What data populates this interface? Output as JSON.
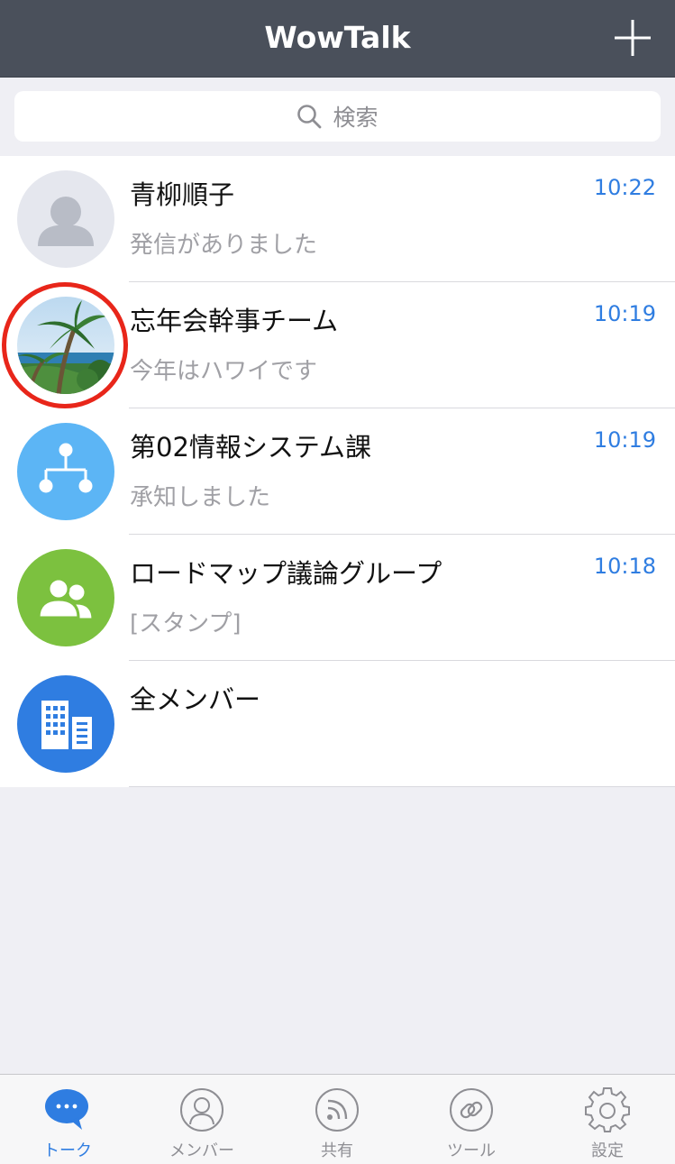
{
  "header": {
    "title": "WowTalk"
  },
  "search": {
    "placeholder": "検索"
  },
  "chats": [
    {
      "name": "青柳順子",
      "time": "10:22",
      "preview": "発信がありました",
      "avatar": "person-icon"
    },
    {
      "name": "忘年会幹事チーム",
      "time": "10:19",
      "preview": "今年はハワイです",
      "avatar": "palm-beach-photo"
    },
    {
      "name": "第02情報システム課",
      "time": "10:19",
      "preview": "承知しました",
      "avatar": "org-chart-icon"
    },
    {
      "name": "ロードマップ議論グループ",
      "time": "10:18",
      "preview": "[スタンプ]",
      "avatar": "group-icon"
    },
    {
      "name": "全メンバー",
      "time": "",
      "preview": "",
      "avatar": "building-icon"
    }
  ],
  "tabs": [
    {
      "label": "トーク",
      "icon": "chat-bubble-icon",
      "active": true
    },
    {
      "label": "メンバー",
      "icon": "member-icon",
      "active": false
    },
    {
      "label": "共有",
      "icon": "share-feed-icon",
      "active": false
    },
    {
      "label": "ツール",
      "icon": "link-icon",
      "active": false
    },
    {
      "label": "設定",
      "icon": "gear-icon",
      "active": false
    }
  ],
  "colors": {
    "header_bg": "#4a505b",
    "accent": "#2f7de1",
    "highlight": "#e8261a"
  }
}
